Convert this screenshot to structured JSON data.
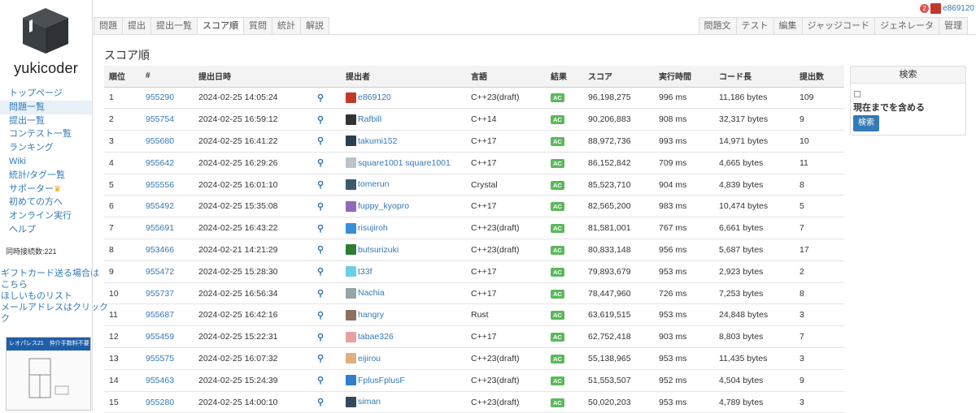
{
  "site_name": "yukicoder",
  "sidebar": {
    "items": [
      {
        "label": "トップページ",
        "active": false
      },
      {
        "label": "問題一覧",
        "active": true
      },
      {
        "label": "提出一覧",
        "active": false
      },
      {
        "label": "コンテスト一覧",
        "active": false
      },
      {
        "label": "ランキング",
        "active": false
      },
      {
        "label": "Wiki",
        "active": false
      },
      {
        "label": "統計/タグ一覧",
        "active": false
      },
      {
        "label": "サポーター",
        "active": false
      },
      {
        "label": "初めての方へ",
        "active": false
      },
      {
        "label": "オンライン実行",
        "active": false
      },
      {
        "label": "ヘルプ",
        "active": false
      }
    ],
    "connections": "同時接続数:221",
    "gift_lines": [
      "ギフトカード送る場合は",
      "こちら",
      "ほしいものリスト",
      "メールアドレスはクリック",
      "ク"
    ],
    "ad_text": "レオパレス21　仲介手数料不要"
  },
  "topbar": {
    "notifications": "2",
    "username": "e869120"
  },
  "tabs_left": [
    "問題",
    "提出",
    "提出一覧",
    "スコア順",
    "質問",
    "統計",
    "解説"
  ],
  "tabs_right": [
    "問題文",
    "テスト",
    "編集",
    "ジャッジコード",
    "ジェネレータ",
    "管理"
  ],
  "active_tab": "スコア順",
  "page_title": "スコア順",
  "table": {
    "headers": [
      "順位",
      "#",
      "提出日時",
      "",
      "提出者",
      "言語",
      "結果",
      "スコア",
      "実行時間",
      "コード長",
      "提出数"
    ],
    "rows": [
      {
        "rank": "1",
        "id": "955290",
        "date": "2024-02-25 14:05:24",
        "user": "e869120",
        "lang": "C++23(draft)",
        "result": "AC",
        "score": "96,198,275",
        "time": "996 ms",
        "len": "11,186 bytes",
        "count": "109",
        "color": "#c0392b"
      },
      {
        "rank": "2",
        "id": "955754",
        "date": "2024-02-25 16:59:12",
        "user": "Rafbill",
        "lang": "C++14",
        "result": "AC",
        "score": "90,206,883",
        "time": "908 ms",
        "len": "32,317 bytes",
        "count": "9",
        "color": "#333333"
      },
      {
        "rank": "3",
        "id": "955680",
        "date": "2024-02-25 16:41:22",
        "user": "takumi152",
        "lang": "C++17",
        "result": "AC",
        "score": "88,972,736",
        "time": "993 ms",
        "len": "14,971 bytes",
        "count": "10",
        "color": "#2c3e50"
      },
      {
        "rank": "4",
        "id": "955642",
        "date": "2024-02-25 16:29:26",
        "user": "square1001 square1001",
        "lang": "C++17",
        "result": "AC",
        "score": "86,152,842",
        "time": "709 ms",
        "len": "4,665 bytes",
        "count": "11",
        "color": "#bdc3c7"
      },
      {
        "rank": "5",
        "id": "955556",
        "date": "2024-02-25 16:01:10",
        "user": "tomerun",
        "lang": "Crystal",
        "result": "AC",
        "score": "85,523,710",
        "time": "904 ms",
        "len": "4,839 bytes",
        "count": "8",
        "color": "#3d5a6b"
      },
      {
        "rank": "6",
        "id": "955492",
        "date": "2024-02-25 15:35:08",
        "user": "fuppy_kyopro",
        "lang": "C++17",
        "result": "AC",
        "score": "82,565,200",
        "time": "983 ms",
        "len": "10,474 bytes",
        "count": "5",
        "color": "#8e6bb8"
      },
      {
        "rank": "7",
        "id": "955691",
        "date": "2024-02-25 16:43:22",
        "user": "risujiroh",
        "lang": "C++23(draft)",
        "result": "AC",
        "score": "81,581,001",
        "time": "767 ms",
        "len": "6,661 bytes",
        "count": "7",
        "color": "#3b8fd4"
      },
      {
        "rank": "8",
        "id": "953466",
        "date": "2024-02-21 14:21:29",
        "user": "butsurizuki",
        "lang": "C++23(draft)",
        "result": "AC",
        "score": "80,833,148",
        "time": "956 ms",
        "len": "5,687 bytes",
        "count": "17",
        "color": "#2e7d32"
      },
      {
        "rank": "9",
        "id": "955472",
        "date": "2024-02-25 15:28:30",
        "user": "t33f",
        "lang": "C++17",
        "result": "AC",
        "score": "79,893,679",
        "time": "953 ms",
        "len": "2,923 bytes",
        "count": "2",
        "color": "#6ad0e8"
      },
      {
        "rank": "10",
        "id": "955737",
        "date": "2024-02-25 16:56:34",
        "user": "Nachia",
        "lang": "C++17",
        "result": "AC",
        "score": "78,447,960",
        "time": "726 ms",
        "len": "7,253 bytes",
        "count": "8",
        "color": "#95a5a6"
      },
      {
        "rank": "11",
        "id": "955687",
        "date": "2024-02-25 16:42:16",
        "user": "hangry",
        "lang": "Rust",
        "result": "AC",
        "score": "63,619,515",
        "time": "953 ms",
        "len": "24,848 bytes",
        "count": "3",
        "color": "#8d6e63"
      },
      {
        "rank": "12",
        "id": "955459",
        "date": "2024-02-25 15:22:31",
        "user": "tabae326",
        "lang": "C++17",
        "result": "AC",
        "score": "62,752,418",
        "time": "903 ms",
        "len": "8,803 bytes",
        "count": "7",
        "color": "#e8a0a0"
      },
      {
        "rank": "13",
        "id": "955575",
        "date": "2024-02-25 16:07:32",
        "user": "eijirou",
        "lang": "C++23(draft)",
        "result": "AC",
        "score": "55,138,965",
        "time": "953 ms",
        "len": "11,435 bytes",
        "count": "3",
        "color": "#e0b080"
      },
      {
        "rank": "14",
        "id": "955463",
        "date": "2024-02-25 15:24:39",
        "user": "FplusFplusF",
        "lang": "C++23(draft)",
        "result": "AC",
        "score": "51,553,507",
        "time": "952 ms",
        "len": "4,504 bytes",
        "count": "9",
        "color": "#2f80c8"
      },
      {
        "rank": "15",
        "id": "955280",
        "date": "2024-02-25 14:00:10",
        "user": "siman",
        "lang": "C++23(draft)",
        "result": "AC",
        "score": "50,020,203",
        "time": "953 ms",
        "len": "4,789 bytes",
        "count": "3",
        "color": "#34495e"
      }
    ]
  },
  "search": {
    "title": "検索",
    "checkbox_label": "現在までを含める",
    "button": "検索"
  }
}
